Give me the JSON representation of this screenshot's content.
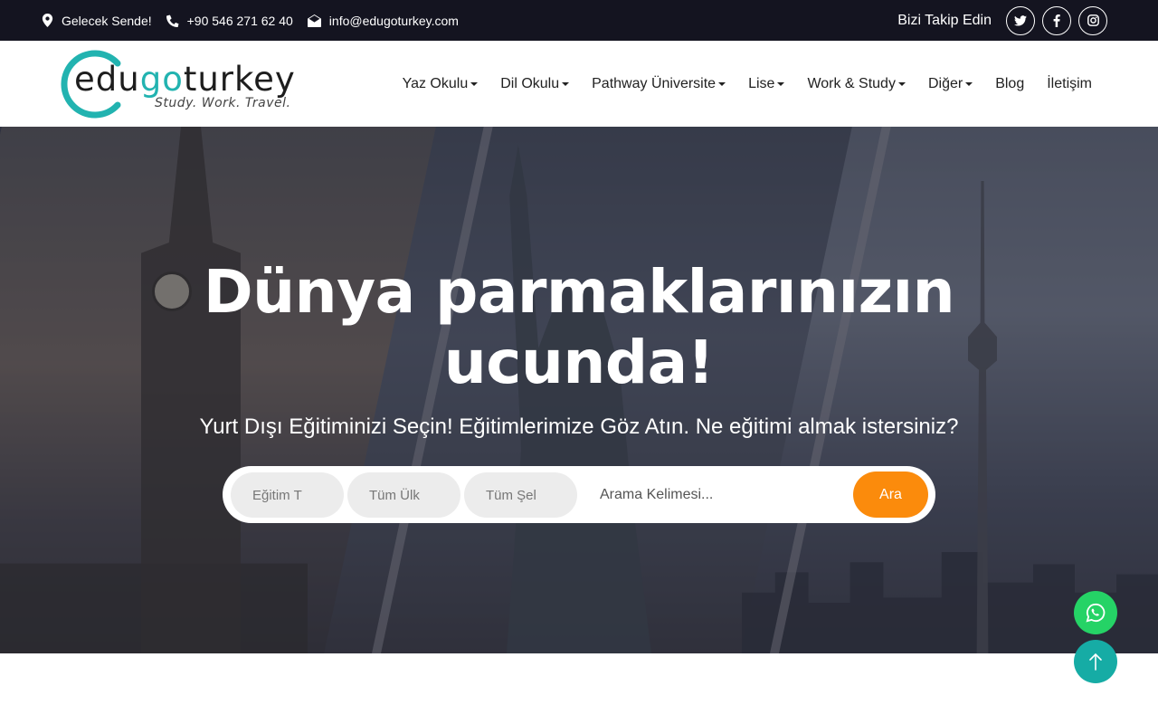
{
  "topbar": {
    "location_text": "Gelecek Sende!",
    "phone": "+90 546 271 62 40",
    "email": "info@edugoturkey.com",
    "follow_label": "Bizi Takip Edin",
    "socials": [
      "twitter-icon",
      "facebook-icon",
      "instagram-icon"
    ],
    "background": "#141420"
  },
  "logo": {
    "word_a": "edu",
    "word_b": "go",
    "word_c": "turkey",
    "tagline": "Study. Work. Travel.",
    "accent": "#22b3b0"
  },
  "nav": {
    "items": [
      {
        "label": "Yaz Okulu",
        "dropdown": true
      },
      {
        "label": "Dil Okulu",
        "dropdown": true
      },
      {
        "label": "Pathway Üniversite",
        "dropdown": true
      },
      {
        "label": "Lise",
        "dropdown": true
      },
      {
        "label": "Work & Study",
        "dropdown": true
      },
      {
        "label": "Diğer",
        "dropdown": true
      },
      {
        "label": "Blog",
        "dropdown": false
      },
      {
        "label": "İletişim",
        "dropdown": false
      }
    ]
  },
  "hero": {
    "title_line1": "Dünya parmaklarınızın",
    "title_line2": "ucunda!",
    "subtitle": "Yurt Dışı Eğitiminizi Seçin! Eğitimlerimize Göz Atın. Ne eğitimi almak istersiniz?"
  },
  "search": {
    "education_type": "Eğitim T",
    "country": "Tüm Ülk",
    "city": "Tüm Şel",
    "keyword_placeholder": "Arama Kelimesi...",
    "submit_label": "Ara",
    "submit_color": "#fb8b0c"
  },
  "floating": {
    "whatsapp_color": "#25d366",
    "scroll_top_color": "#16aca5"
  }
}
